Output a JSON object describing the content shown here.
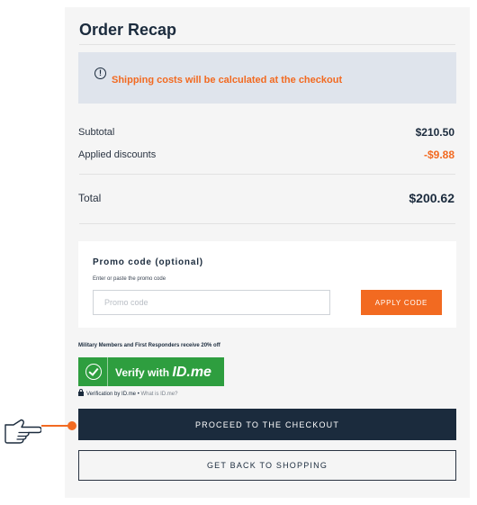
{
  "order": {
    "title": "Order Recap",
    "shipping_notice": "Shipping costs will be calculated at the checkout",
    "notice_icon": "info-icon",
    "subtotal_label": "Subtotal",
    "subtotal_value": "$210.50",
    "discounts_label": "Applied discounts",
    "discounts_value": "-$9.88",
    "total_label": "Total",
    "total_value": "$200.62"
  },
  "promo": {
    "title": "Promo code (optional)",
    "hint": "Enter or paste the promo code",
    "placeholder": "Promo code",
    "value": "",
    "apply_label": "APPLY CODE"
  },
  "idme": {
    "military_text": "Military Members and First Responders receive 20% off",
    "verify_label": "Verify with",
    "logo_text": "ID.me",
    "verification_by": "Verification by ID.me •",
    "what_is": "What is ID.me?"
  },
  "actions": {
    "checkout_label": "PROCEED TO THE CHECKOUT",
    "back_label": "GET BACK TO SHOPPING"
  },
  "colors": {
    "accent": "#f26a21",
    "primary": "#1b2b3d",
    "idme_green": "#2e9e3f",
    "notice_bg": "#dfe4ec"
  }
}
